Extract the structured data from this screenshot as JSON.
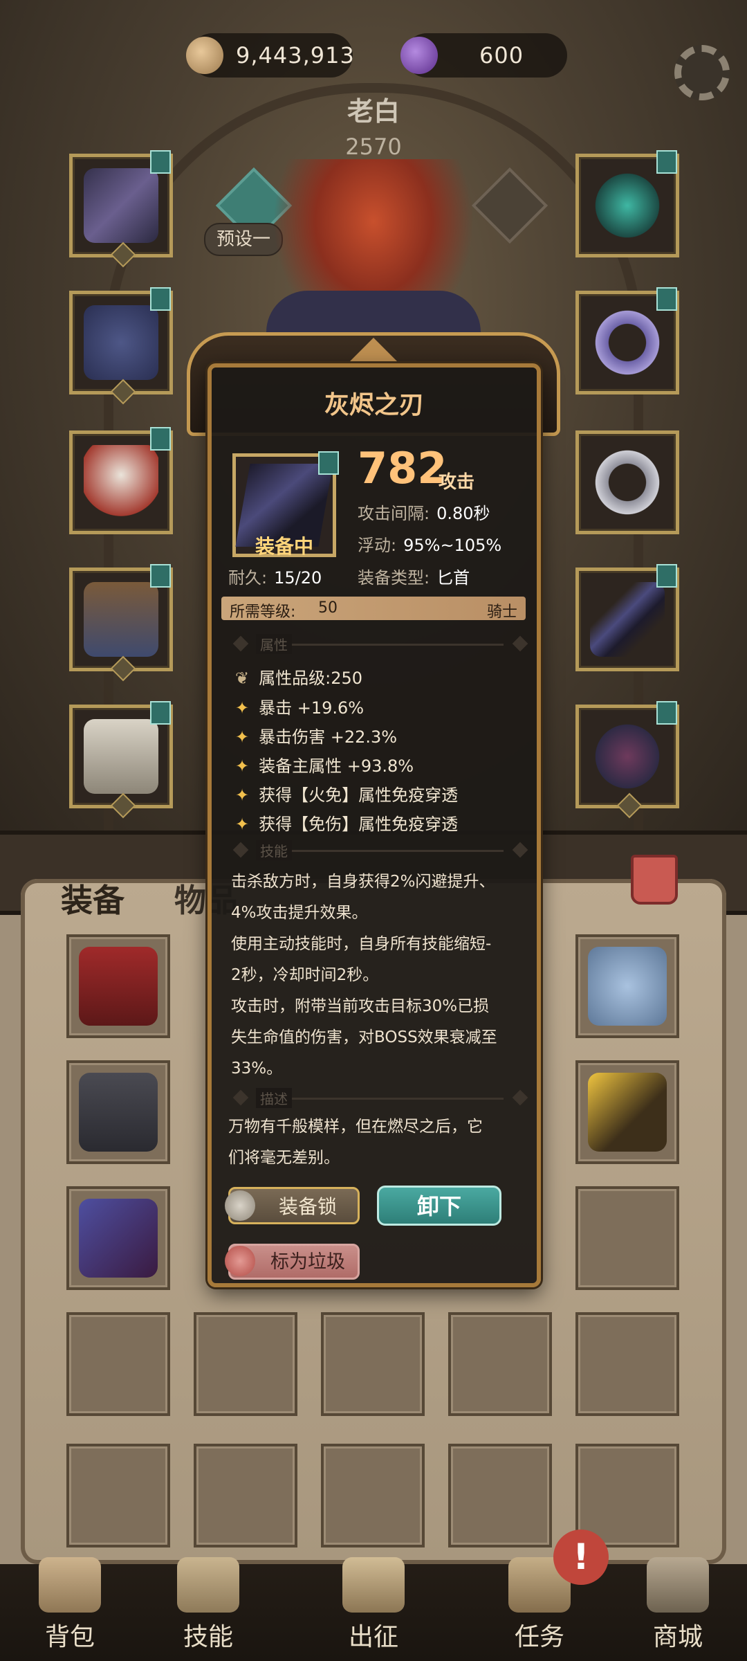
{
  "header": {
    "gold_amount": "9,443,913",
    "gem_amount": "600",
    "player_name": "老白",
    "player_power": "2570",
    "preset_label": "预设一"
  },
  "icons": {
    "gold": "gold-coin-icon",
    "gem": "purple-gem-icon",
    "settings": "gear-icon"
  },
  "tabs": {
    "equipment": "装备",
    "items": "物品"
  },
  "tooltip": {
    "title": "灰烬之刃",
    "equipped_label": "装备中",
    "attack_value": "782",
    "attack_unit": "攻击",
    "attack_interval_label": "攻击间隔:",
    "attack_interval_value": "0.80秒",
    "float_label": "浮动:",
    "float_value": "95%~105%",
    "durability_label": "耐久:",
    "durability_value": "15/20",
    "type_label": "装备类型:",
    "type_value": "匕首",
    "required_level_label": "所需等级:",
    "required_level_value": "50",
    "class_value": "骑士",
    "section_attributes": "属性",
    "attribute_grade": "属性品级:250",
    "attributes": [
      "暴击 +19.6%",
      "暴击伤害 +22.3%",
      "装备主属性 +93.8%",
      "获得【火免】属性免疫穿透",
      "获得【免伤】属性免疫穿透"
    ],
    "section_skills": "技能",
    "skill_lines": [
      "击杀敌方时，自身获得2%闪避提升、",
      "4%攻击提升效果。",
      "使用主动技能时，自身所有技能缩短-",
      "2秒，冷却时间2秒。",
      "攻击时，附带当前攻击目标30%已损",
      "失生命值的伤害，对BOSS效果衰减至",
      "33%。"
    ],
    "section_description": "描述",
    "lore_lines": [
      "万物有千般模样，但在燃尽之后，它",
      "们将毫无差别。"
    ],
    "buttons": {
      "lock": "装备锁",
      "unequip": "卸下",
      "mark_junk": "标为垃圾"
    }
  },
  "nav": [
    {
      "label": "背包"
    },
    {
      "label": "技能"
    },
    {
      "label": "出征"
    },
    {
      "label": "任务"
    },
    {
      "label": "商城"
    }
  ],
  "alert_badge": "!",
  "colors": {
    "accent_gold": "#c7a765",
    "tooltip_title": "#f2c58a",
    "unequip_button": "#3a958d",
    "junk_button": "#c07c77"
  }
}
